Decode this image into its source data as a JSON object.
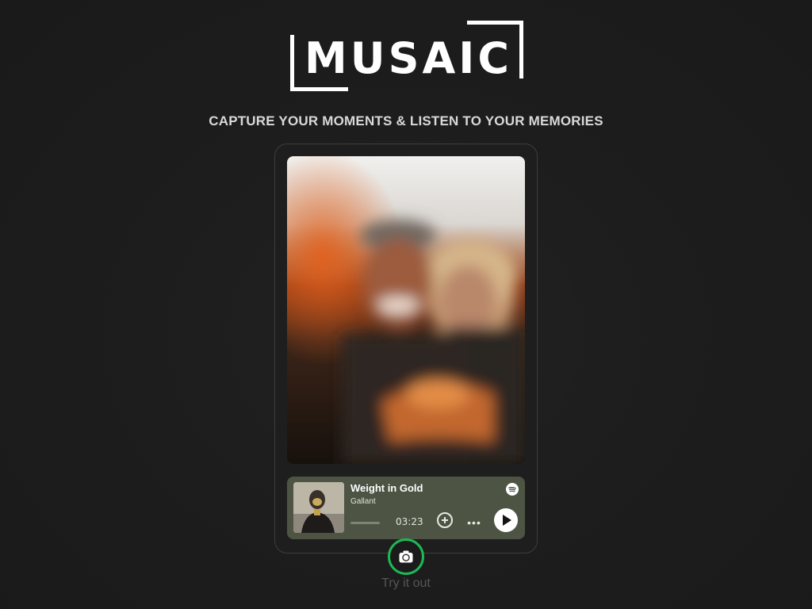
{
  "brand": {
    "logo_text": "MUSAIC",
    "tagline": "CAPTURE YOUR MOMENTS & LISTEN TO YOUR MEMORIES"
  },
  "photo": {
    "description_icon": "selfie-photo"
  },
  "player": {
    "title": "Weight in Gold",
    "artist": "Gallant",
    "duration": "03:23",
    "progress": 0.0,
    "service_icon": "spotify-icon",
    "colors": {
      "background": "#4d5444",
      "accent": "#1db954"
    }
  },
  "cta": {
    "icon": "camera-icon",
    "label": "Try it out"
  }
}
